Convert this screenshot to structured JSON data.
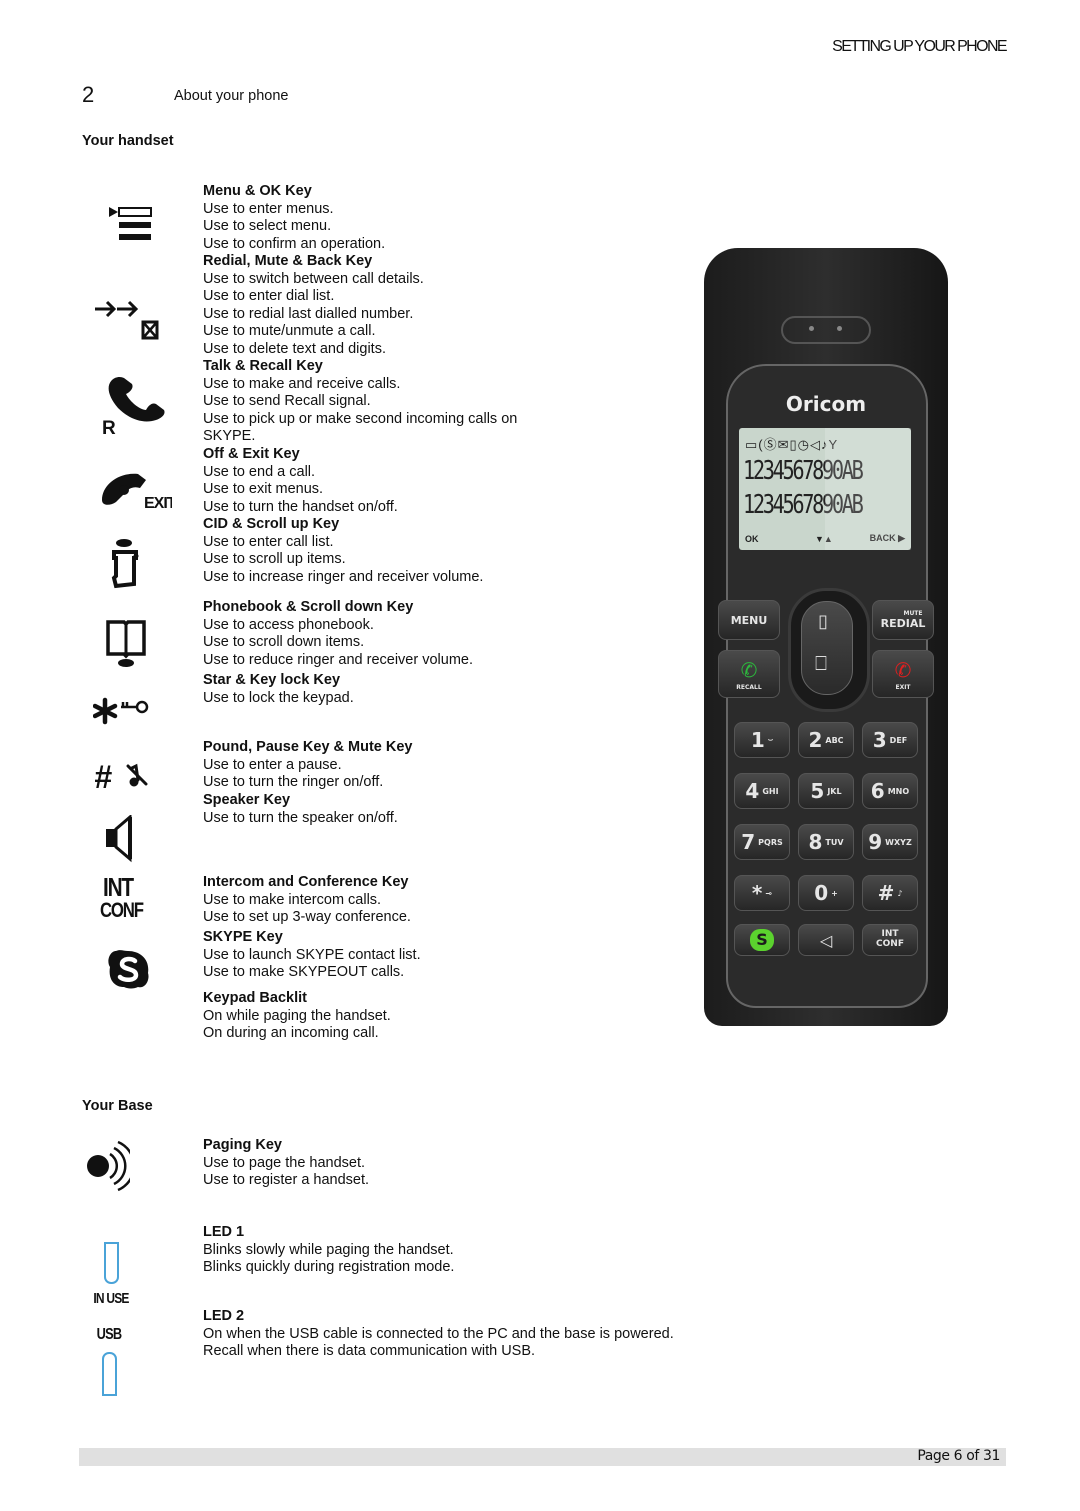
{
  "header": {
    "running_title": "SETTING UP YOUR PHONE"
  },
  "chapter": {
    "number": "2",
    "title": "About your phone"
  },
  "handset": {
    "heading": "Your handset",
    "entries": [
      {
        "title": "Menu & OK Key",
        "icon": "menu-ok-icon",
        "lines": [
          "Use to enter menus.",
          "Use to select menu.",
          "Use to confirm an operation."
        ]
      },
      {
        "title": "Redial, Mute & Back Key",
        "icon": "redial-mute-icon",
        "lines": [
          "Use to switch between call details.",
          "Use to enter dial list.",
          "Use to redial last dialled number.",
          "Use to mute/unmute a call.",
          "Use to delete text and digits."
        ]
      },
      {
        "title": "Talk & Recall Key",
        "icon": "talk-recall-icon",
        "lines": [
          "Use to make and receive calls.",
          "Use to send Recall signal.",
          "Use to pick up or make second incoming calls on",
          "SKYPE."
        ]
      },
      {
        "title": "Off & Exit Key",
        "icon": "off-exit-icon",
        "lines": [
          "Use to end a call.",
          "Use to exit menus.",
          "Use to turn the handset on/off."
        ]
      },
      {
        "title": "CID & Scroll up Key",
        "icon": "cid-scroll-up-icon",
        "lines": [
          "Use to enter call list.",
          "Use to scroll up items.",
          "Use to increase ringer and receiver volume."
        ]
      },
      {
        "title": "Phonebook & Scroll down Key",
        "icon": "phonebook-scroll-down-icon",
        "lines": [
          "Use to access phonebook.",
          "Use to scroll down items.",
          "Use to reduce ringer and receiver volume."
        ]
      },
      {
        "title": "Star & Key lock Key",
        "icon": "star-keylock-icon",
        "lines": [
          "Use to lock the keypad."
        ]
      },
      {
        "title": "Pound, Pause Key & Mute Key",
        "icon": "pound-mute-icon",
        "lines": [
          "Use to enter a pause.",
          "Use to turn the ringer on/off."
        ]
      },
      {
        "title": "Speaker Key",
        "icon": "speaker-icon",
        "lines": [
          "Use to turn the speaker on/off."
        ]
      },
      {
        "title": "Intercom and Conference Key",
        "icon": "int-conf-icon",
        "lines": [
          "Use to make intercom calls.",
          "Use to set up 3-way conference."
        ]
      },
      {
        "title": "SKYPE Key",
        "icon": "skype-icon",
        "lines": [
          "Use to launch SKYPE contact list.",
          "Use to make SKYPEOUT calls."
        ]
      },
      {
        "title": "Keypad Backlit",
        "icon": "",
        "lines": [
          "On while paging the handset.",
          "On during an incoming call."
        ]
      }
    ],
    "icon_labels": {
      "recall": "R",
      "exit": "EXIT",
      "int": "INT",
      "conf": "CONF"
    }
  },
  "base": {
    "heading": "Your Base",
    "entries": [
      {
        "title": "Paging Key",
        "icon": "paging-icon",
        "lines": [
          "Use to page the handset.",
          "Use to register a handset."
        ]
      },
      {
        "title": "LED 1",
        "icon": "led-in-use-icon",
        "lines": [
          "Blinks slowly while paging the handset.",
          "Blinks quickly during registration mode."
        ]
      },
      {
        "title": "LED 2",
        "icon": "led-usb-icon",
        "lines": [
          "On when the USB cable is connected to the PC and the base is powered.",
          "Recall when there is data communication with USB."
        ]
      }
    ],
    "icon_labels": {
      "in_use": "IN USE",
      "usb": "USB"
    },
    "led_color": "#4aa3d8"
  },
  "phone_image": {
    "brand": "Oricom",
    "lcd": {
      "line1": "1234567890AB",
      "line2": "1234567890AB",
      "soft_left": "OK",
      "soft_mid": "▼▲",
      "soft_right": "BACK ▶"
    },
    "buttons": {
      "menu": "MENU",
      "mute": "MUTE",
      "redial": "REDIAL",
      "recall": "RECALL",
      "exit": "EXIT",
      "int": "INT",
      "conf": "CONF"
    },
    "keys": [
      {
        "n": "1",
        "l": "⌣"
      },
      {
        "n": "2",
        "l": "ABC"
      },
      {
        "n": "3",
        "l": "DEF"
      },
      {
        "n": "4",
        "l": "GHI"
      },
      {
        "n": "5",
        "l": "JKL"
      },
      {
        "n": "6",
        "l": "MNO"
      },
      {
        "n": "7",
        "l": "PQRS"
      },
      {
        "n": "8",
        "l": "TUV"
      },
      {
        "n": "9",
        "l": "WXYZ"
      },
      {
        "n": "*",
        "l": "⊸"
      },
      {
        "n": "0",
        "l": "+"
      },
      {
        "n": "#",
        "l": "♪"
      }
    ],
    "colors": {
      "talk": "#2db83d",
      "end": "#e02020",
      "skype": "#5bd22e",
      "lcd": "#c9d6cc"
    }
  },
  "footer": {
    "page": "Page 6 of 31"
  }
}
